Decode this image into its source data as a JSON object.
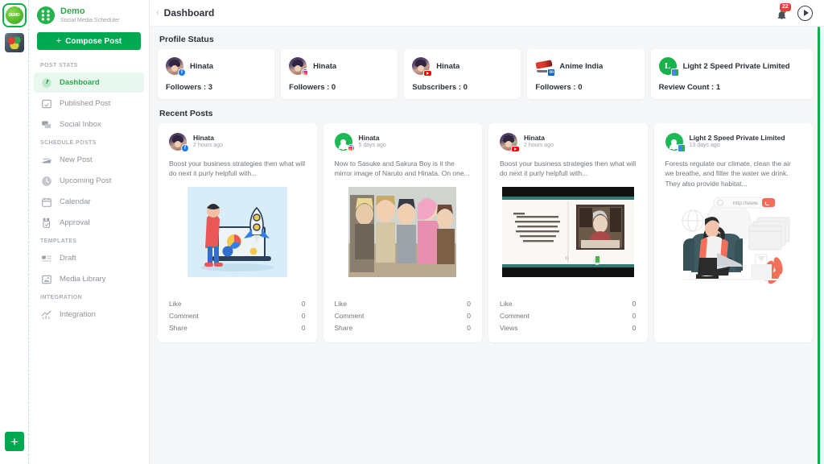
{
  "rail": {
    "workspaces": [
      {
        "name": "demo-workspace",
        "active": true
      },
      {
        "name": "anime-workspace",
        "active": false
      }
    ],
    "add_label": "+"
  },
  "sidebar": {
    "brand": {
      "name": "Demo",
      "subtitle": "Social Media Scheduler",
      "logo_icon": "grid-dots-icon"
    },
    "compose": {
      "label": "Compose Post",
      "plus": "+"
    },
    "sections": [
      {
        "title": "POST STATS",
        "items": [
          {
            "label": "Dashboard",
            "icon": "dashboard-icon",
            "active": true
          },
          {
            "label": "Published Post",
            "icon": "published-post-icon",
            "active": false
          },
          {
            "label": "Social Inbox",
            "icon": "social-inbox-icon",
            "active": false
          }
        ]
      },
      {
        "title": "SCHEDULE POSTS",
        "items": [
          {
            "label": "New Post",
            "icon": "new-post-icon",
            "active": false
          },
          {
            "label": "Upcoming Post",
            "icon": "clock-icon",
            "active": false
          },
          {
            "label": "Calendar",
            "icon": "calendar-icon",
            "active": false
          },
          {
            "label": "Approval",
            "icon": "approval-icon",
            "active": false
          }
        ]
      },
      {
        "title": "TEMPLATES",
        "items": [
          {
            "label": "Draft",
            "icon": "draft-icon",
            "active": false
          },
          {
            "label": "Media Library",
            "icon": "media-library-icon",
            "active": false
          }
        ]
      },
      {
        "title": "INTEGRATION",
        "items": [
          {
            "label": "Integration",
            "icon": "integration-chart-icon",
            "active": false
          }
        ]
      }
    ]
  },
  "topbar": {
    "collapse_icon": "chevron-left-icon",
    "title": "Dashboard",
    "notification": {
      "icon": "bell-icon",
      "count": "22"
    },
    "profile": {
      "icon": "play-avatar-icon"
    }
  },
  "profile_status": {
    "title": "Profile Status",
    "cards": [
      {
        "name": "Hinata",
        "stat_label": "Followers",
        "stat_value": "3",
        "stat_text": "Followers : 3",
        "network": "facebook",
        "avatar": "hinata-avatar"
      },
      {
        "name": "Hinata",
        "stat_label": "Followers",
        "stat_value": "0",
        "stat_text": "Followers : 0",
        "network": "instagram",
        "avatar": "hinata-avatar"
      },
      {
        "name": "Hinata",
        "stat_label": "Subscribers",
        "stat_value": "0",
        "stat_text": "Subscribers : 0",
        "network": "youtube",
        "avatar": "hinata-avatar"
      },
      {
        "name": "Anime India",
        "stat_label": "Followers",
        "stat_value": "0",
        "stat_text": "Followers : 0",
        "network": "linkedin",
        "avatar": "anime-india-avatar"
      },
      {
        "name": "Light 2 Speed Private Limited",
        "stat_label": "Review Count",
        "stat_value": "1",
        "stat_text": "Review Count : 1",
        "network": "google-business",
        "avatar": "l2s-avatar"
      }
    ]
  },
  "recent_posts": {
    "title": "Recent Posts",
    "cards": [
      {
        "author": "Hinata",
        "time": "2 hours ago",
        "text": "Boost your business strategies then what will do next it purly helpfull with...",
        "network": "facebook",
        "avatar": "hinata-avatar",
        "media": "laptop-rocket-illustration",
        "stats": [
          {
            "label": "Like",
            "value": "0"
          },
          {
            "label": "Comment",
            "value": "0"
          },
          {
            "label": "Share",
            "value": "0"
          }
        ]
      },
      {
        "author": "Hinata",
        "time": "5 days ago",
        "text": "Now to Sasuke and Sakura Boy is it the mirror image of Naruto and Hinata. On one...",
        "network": "instagram",
        "avatar": "green-person-avatar",
        "media": "anime-characters-photo",
        "stats": [
          {
            "label": "Like",
            "value": "0"
          },
          {
            "label": "Comment",
            "value": "0"
          },
          {
            "label": "Share",
            "value": "0"
          }
        ]
      },
      {
        "author": "Hinata",
        "time": "2 hours ago",
        "text": "Boost your business strategies then what will do next it purly helpfull with...",
        "network": "youtube",
        "avatar": "hinata-avatar",
        "media": "open-book-video-thumbnail",
        "stats": [
          {
            "label": "Like",
            "value": "0"
          },
          {
            "label": "Comment",
            "value": "0"
          },
          {
            "label": "Views",
            "value": "0"
          }
        ]
      },
      {
        "author": "Light 2 Speed Private Limited",
        "time": "13 days ago",
        "text": "Forests regulate our climate, clean the air we breathe, and filter the water we drink. They also provide habitat...",
        "network": "google-business",
        "avatar": "green-person-avatar",
        "media": "woman-laptop-illustration",
        "stats": []
      }
    ]
  },
  "colors": {
    "accent_green": "#00a94f",
    "active_nav_bg": "#e8f8ee",
    "badge_red": "#e8413a",
    "page_bg": "#f4f6f8",
    "scrollbar": "#0bb14b"
  }
}
